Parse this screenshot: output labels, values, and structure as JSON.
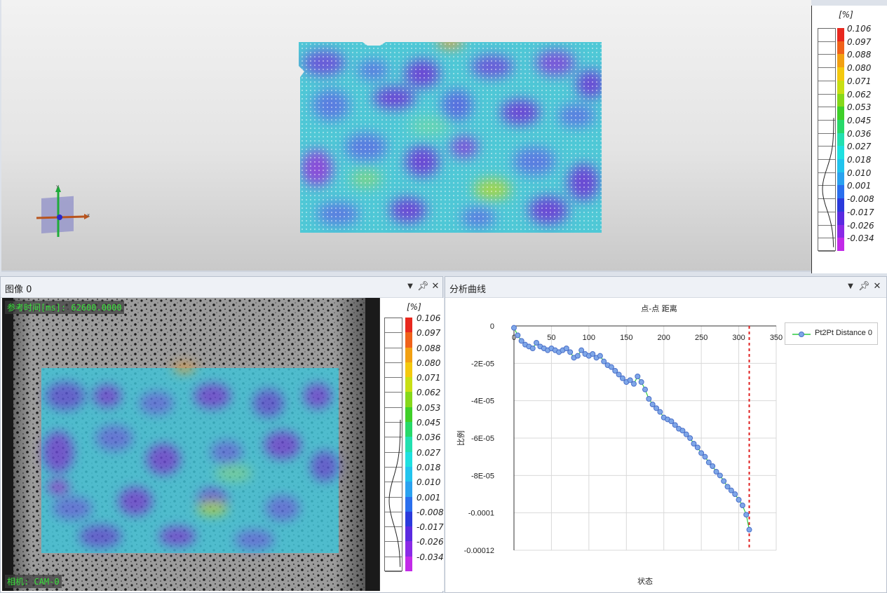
{
  "scale": {
    "unit": "[%]",
    "labels": [
      "0.106",
      "0.097",
      "0.088",
      "0.080",
      "0.071",
      "0.062",
      "0.053",
      "0.045",
      "0.036",
      "0.027",
      "0.018",
      "0.010",
      "0.001",
      "-0.008",
      "-0.017",
      "-0.026",
      "-0.034"
    ],
    "colors": [
      "#e8281e",
      "#f0621a",
      "#f2a012",
      "#f4c90e",
      "#c8df14",
      "#86d81a",
      "#3fcf28",
      "#27d96a",
      "#22e0b0",
      "#1ee0e0",
      "#22c4ee",
      "#2aa2f0",
      "#2a6fee",
      "#2a3adc",
      "#5a2ae0",
      "#8a2ae6",
      "#c22ae8"
    ]
  },
  "panels": {
    "image": {
      "title": "图像 0",
      "ref_time": "参考时间[ms]: 62600.0000",
      "camera": "相机: CAM-0"
    },
    "curve": {
      "title": "分析曲线"
    }
  },
  "header_icons": [
    "chevron-down-icon",
    "pin-icon",
    "close-icon"
  ],
  "chart_data": {
    "type": "scatter",
    "title": "点-点 距离",
    "xlabel": "状态",
    "ylabel": "比例",
    "xlim": [
      0,
      350
    ],
    "ylim": [
      -0.00012,
      0
    ],
    "xticks": [
      "0",
      "50",
      "100",
      "150",
      "200",
      "250",
      "300",
      "350"
    ],
    "yticks": [
      "0",
      "-2E-05",
      "-4E-05",
      "-6E-05",
      "-8E-05",
      "-0.0001",
      "-0.00012"
    ],
    "grid": true,
    "legend_position": "top-right",
    "marker_line_x": 314,
    "series": [
      {
        "name": "Pt2Pt Distance 0",
        "color": "#7fa7e8",
        "line_color": "#2ecc40",
        "x": [
          0,
          5,
          10,
          15,
          20,
          25,
          30,
          35,
          40,
          45,
          50,
          55,
          60,
          65,
          70,
          75,
          80,
          85,
          90,
          95,
          100,
          105,
          110,
          115,
          120,
          125,
          130,
          135,
          140,
          145,
          150,
          155,
          160,
          165,
          170,
          175,
          180,
          185,
          190,
          195,
          200,
          205,
          210,
          215,
          220,
          225,
          230,
          235,
          240,
          245,
          250,
          255,
          260,
          265,
          270,
          275,
          280,
          285,
          290,
          295,
          300,
          305,
          310,
          314
        ],
        "y": [
          -1e-06,
          -5e-06,
          -8e-06,
          -1e-05,
          -1.1e-05,
          -1.2e-05,
          -9e-06,
          -1.1e-05,
          -1.2e-05,
          -1.3e-05,
          -1.2e-05,
          -1.3e-05,
          -1.4e-05,
          -1.3e-05,
          -1.2e-05,
          -1.4e-05,
          -1.7e-05,
          -1.6e-05,
          -1.3e-05,
          -1.5e-05,
          -1.6e-05,
          -1.5e-05,
          -1.7e-05,
          -1.6e-05,
          -1.9e-05,
          -2.1e-05,
          -2.2e-05,
          -2.4e-05,
          -2.6e-05,
          -2.8e-05,
          -3e-05,
          -2.9e-05,
          -3.1e-05,
          -2.7e-05,
          -3e-05,
          -3.4e-05,
          -3.9e-05,
          -4.2e-05,
          -4.4e-05,
          -4.6e-05,
          -4.9e-05,
          -5e-05,
          -5.1e-05,
          -5.3e-05,
          -5.5e-05,
          -5.6e-05,
          -5.8e-05,
          -6e-05,
          -6.3e-05,
          -6.5e-05,
          -6.8e-05,
          -7e-05,
          -7.3e-05,
          -7.5e-05,
          -7.8e-05,
          -8e-05,
          -8.3e-05,
          -8.6e-05,
          -8.8e-05,
          -9e-05,
          -9.3e-05,
          -9.6e-05,
          -0.000101,
          -0.000109
        ]
      }
    ]
  }
}
